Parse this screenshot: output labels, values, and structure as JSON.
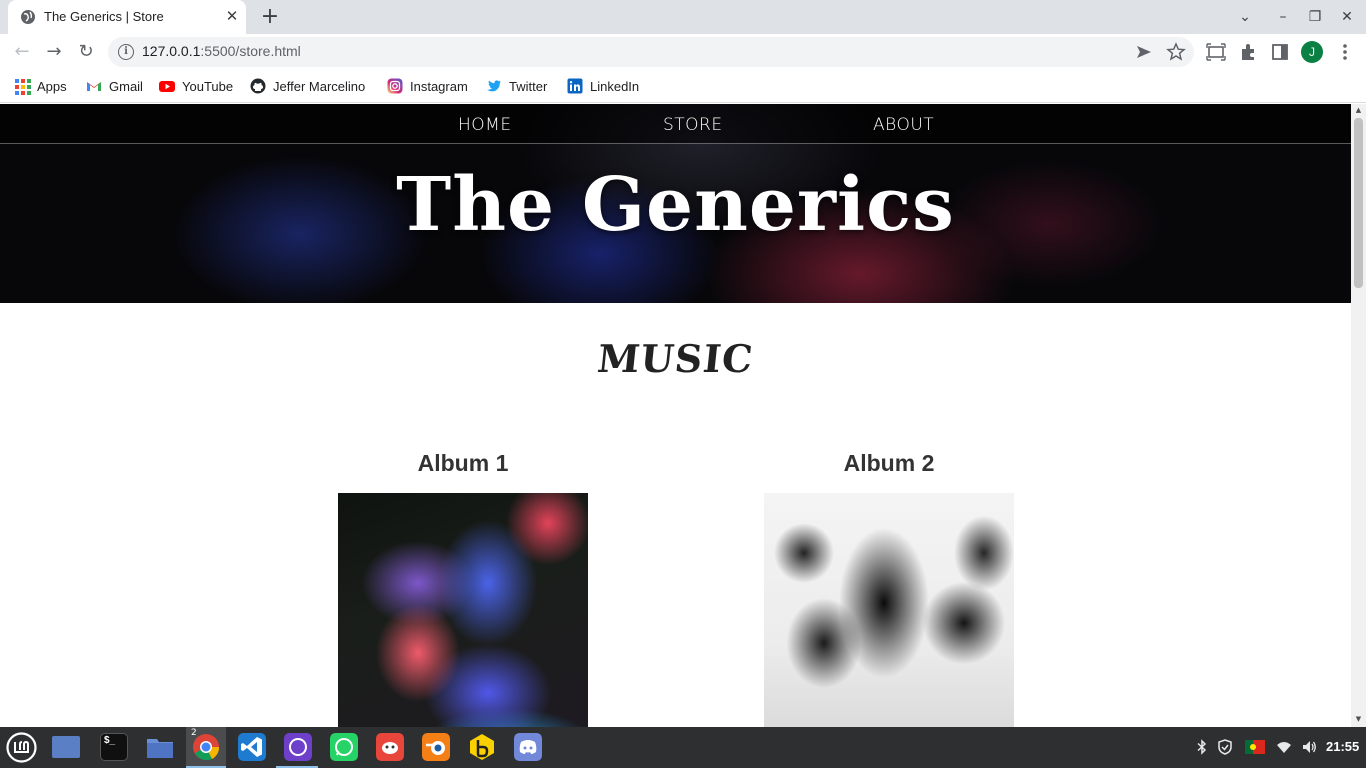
{
  "browser": {
    "tab": {
      "title": "The Generics | Store",
      "close_glyph": "✕"
    },
    "new_tab_glyph": "+",
    "window_controls": {
      "dropdown": "⌄",
      "minimize": "–",
      "restore": "❐",
      "close": "✕"
    },
    "nav": {
      "back": "←",
      "forward": "→",
      "reload": "↻"
    },
    "address": {
      "host": "127.0.0.1",
      "path": ":5500/store.html"
    },
    "profile_initial": "J",
    "bookmarks": [
      {
        "label": "Apps",
        "icon": "apps-grid-icon"
      },
      {
        "label": "Gmail",
        "icon": "gmail-icon"
      },
      {
        "label": "YouTube",
        "icon": "youtube-icon"
      },
      {
        "label": "Jeffer Marcelino",
        "icon": "github-icon"
      },
      {
        "label": "Instagram",
        "icon": "instagram-icon"
      },
      {
        "label": "Twitter",
        "icon": "twitter-icon"
      },
      {
        "label": "LinkedIn",
        "icon": "linkedin-icon"
      }
    ]
  },
  "page": {
    "nav": {
      "home": "HOME",
      "store": "STORE",
      "about": "ABOUT"
    },
    "band_name": "The Generics",
    "section_title": "MUSIC",
    "albums": [
      {
        "title": "Album 1"
      },
      {
        "title": "Album 2"
      }
    ]
  },
  "taskbar": {
    "chrome_badge": "2",
    "apps": [
      {
        "name": "mint-menu-icon"
      },
      {
        "name": "show-desktop-icon"
      },
      {
        "name": "terminal-icon"
      },
      {
        "name": "files-icon"
      },
      {
        "name": "chrome-icon"
      },
      {
        "name": "vscode-icon"
      },
      {
        "name": "github-desktop-icon"
      },
      {
        "name": "whatsapp-icon"
      },
      {
        "name": "gimp-icon"
      },
      {
        "name": "blender-icon"
      },
      {
        "name": "beekeeper-icon"
      },
      {
        "name": "discord-icon"
      }
    ],
    "clock": "21:55"
  },
  "colors": {
    "tabstrip": "#dee1e6",
    "profile": "#0b8043",
    "taskbar": "#2e2f30"
  }
}
